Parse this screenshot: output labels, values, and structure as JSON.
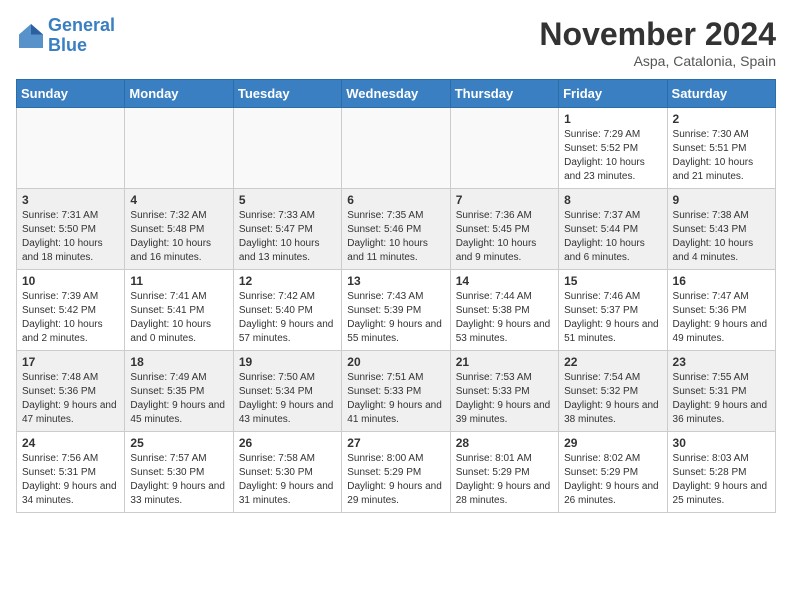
{
  "header": {
    "logo_line1": "General",
    "logo_line2": "Blue",
    "month_title": "November 2024",
    "location": "Aspa, Catalonia, Spain"
  },
  "weekdays": [
    "Sunday",
    "Monday",
    "Tuesday",
    "Wednesday",
    "Thursday",
    "Friday",
    "Saturday"
  ],
  "weeks": [
    [
      {
        "day": "",
        "empty": true
      },
      {
        "day": "",
        "empty": true
      },
      {
        "day": "",
        "empty": true
      },
      {
        "day": "",
        "empty": true
      },
      {
        "day": "",
        "empty": true
      },
      {
        "day": "1",
        "sunrise": "Sunrise: 7:29 AM",
        "sunset": "Sunset: 5:52 PM",
        "daylight": "Daylight: 10 hours and 23 minutes."
      },
      {
        "day": "2",
        "sunrise": "Sunrise: 7:30 AM",
        "sunset": "Sunset: 5:51 PM",
        "daylight": "Daylight: 10 hours and 21 minutes."
      }
    ],
    [
      {
        "day": "3",
        "sunrise": "Sunrise: 7:31 AM",
        "sunset": "Sunset: 5:50 PM",
        "daylight": "Daylight: 10 hours and 18 minutes."
      },
      {
        "day": "4",
        "sunrise": "Sunrise: 7:32 AM",
        "sunset": "Sunset: 5:48 PM",
        "daylight": "Daylight: 10 hours and 16 minutes."
      },
      {
        "day": "5",
        "sunrise": "Sunrise: 7:33 AM",
        "sunset": "Sunset: 5:47 PM",
        "daylight": "Daylight: 10 hours and 13 minutes."
      },
      {
        "day": "6",
        "sunrise": "Sunrise: 7:35 AM",
        "sunset": "Sunset: 5:46 PM",
        "daylight": "Daylight: 10 hours and 11 minutes."
      },
      {
        "day": "7",
        "sunrise": "Sunrise: 7:36 AM",
        "sunset": "Sunset: 5:45 PM",
        "daylight": "Daylight: 10 hours and 9 minutes."
      },
      {
        "day": "8",
        "sunrise": "Sunrise: 7:37 AM",
        "sunset": "Sunset: 5:44 PM",
        "daylight": "Daylight: 10 hours and 6 minutes."
      },
      {
        "day": "9",
        "sunrise": "Sunrise: 7:38 AM",
        "sunset": "Sunset: 5:43 PM",
        "daylight": "Daylight: 10 hours and 4 minutes."
      }
    ],
    [
      {
        "day": "10",
        "sunrise": "Sunrise: 7:39 AM",
        "sunset": "Sunset: 5:42 PM",
        "daylight": "Daylight: 10 hours and 2 minutes."
      },
      {
        "day": "11",
        "sunrise": "Sunrise: 7:41 AM",
        "sunset": "Sunset: 5:41 PM",
        "daylight": "Daylight: 10 hours and 0 minutes."
      },
      {
        "day": "12",
        "sunrise": "Sunrise: 7:42 AM",
        "sunset": "Sunset: 5:40 PM",
        "daylight": "Daylight: 9 hours and 57 minutes."
      },
      {
        "day": "13",
        "sunrise": "Sunrise: 7:43 AM",
        "sunset": "Sunset: 5:39 PM",
        "daylight": "Daylight: 9 hours and 55 minutes."
      },
      {
        "day": "14",
        "sunrise": "Sunrise: 7:44 AM",
        "sunset": "Sunset: 5:38 PM",
        "daylight": "Daylight: 9 hours and 53 minutes."
      },
      {
        "day": "15",
        "sunrise": "Sunrise: 7:46 AM",
        "sunset": "Sunset: 5:37 PM",
        "daylight": "Daylight: 9 hours and 51 minutes."
      },
      {
        "day": "16",
        "sunrise": "Sunrise: 7:47 AM",
        "sunset": "Sunset: 5:36 PM",
        "daylight": "Daylight: 9 hours and 49 minutes."
      }
    ],
    [
      {
        "day": "17",
        "sunrise": "Sunrise: 7:48 AM",
        "sunset": "Sunset: 5:36 PM",
        "daylight": "Daylight: 9 hours and 47 minutes."
      },
      {
        "day": "18",
        "sunrise": "Sunrise: 7:49 AM",
        "sunset": "Sunset: 5:35 PM",
        "daylight": "Daylight: 9 hours and 45 minutes."
      },
      {
        "day": "19",
        "sunrise": "Sunrise: 7:50 AM",
        "sunset": "Sunset: 5:34 PM",
        "daylight": "Daylight: 9 hours and 43 minutes."
      },
      {
        "day": "20",
        "sunrise": "Sunrise: 7:51 AM",
        "sunset": "Sunset: 5:33 PM",
        "daylight": "Daylight: 9 hours and 41 minutes."
      },
      {
        "day": "21",
        "sunrise": "Sunrise: 7:53 AM",
        "sunset": "Sunset: 5:33 PM",
        "daylight": "Daylight: 9 hours and 39 minutes."
      },
      {
        "day": "22",
        "sunrise": "Sunrise: 7:54 AM",
        "sunset": "Sunset: 5:32 PM",
        "daylight": "Daylight: 9 hours and 38 minutes."
      },
      {
        "day": "23",
        "sunrise": "Sunrise: 7:55 AM",
        "sunset": "Sunset: 5:31 PM",
        "daylight": "Daylight: 9 hours and 36 minutes."
      }
    ],
    [
      {
        "day": "24",
        "sunrise": "Sunrise: 7:56 AM",
        "sunset": "Sunset: 5:31 PM",
        "daylight": "Daylight: 9 hours and 34 minutes."
      },
      {
        "day": "25",
        "sunrise": "Sunrise: 7:57 AM",
        "sunset": "Sunset: 5:30 PM",
        "daylight": "Daylight: 9 hours and 33 minutes."
      },
      {
        "day": "26",
        "sunrise": "Sunrise: 7:58 AM",
        "sunset": "Sunset: 5:30 PM",
        "daylight": "Daylight: 9 hours and 31 minutes."
      },
      {
        "day": "27",
        "sunrise": "Sunrise: 8:00 AM",
        "sunset": "Sunset: 5:29 PM",
        "daylight": "Daylight: 9 hours and 29 minutes."
      },
      {
        "day": "28",
        "sunrise": "Sunrise: 8:01 AM",
        "sunset": "Sunset: 5:29 PM",
        "daylight": "Daylight: 9 hours and 28 minutes."
      },
      {
        "day": "29",
        "sunrise": "Sunrise: 8:02 AM",
        "sunset": "Sunset: 5:29 PM",
        "daylight": "Daylight: 9 hours and 26 minutes."
      },
      {
        "day": "30",
        "sunrise": "Sunrise: 8:03 AM",
        "sunset": "Sunset: 5:28 PM",
        "daylight": "Daylight: 9 hours and 25 minutes."
      }
    ]
  ]
}
